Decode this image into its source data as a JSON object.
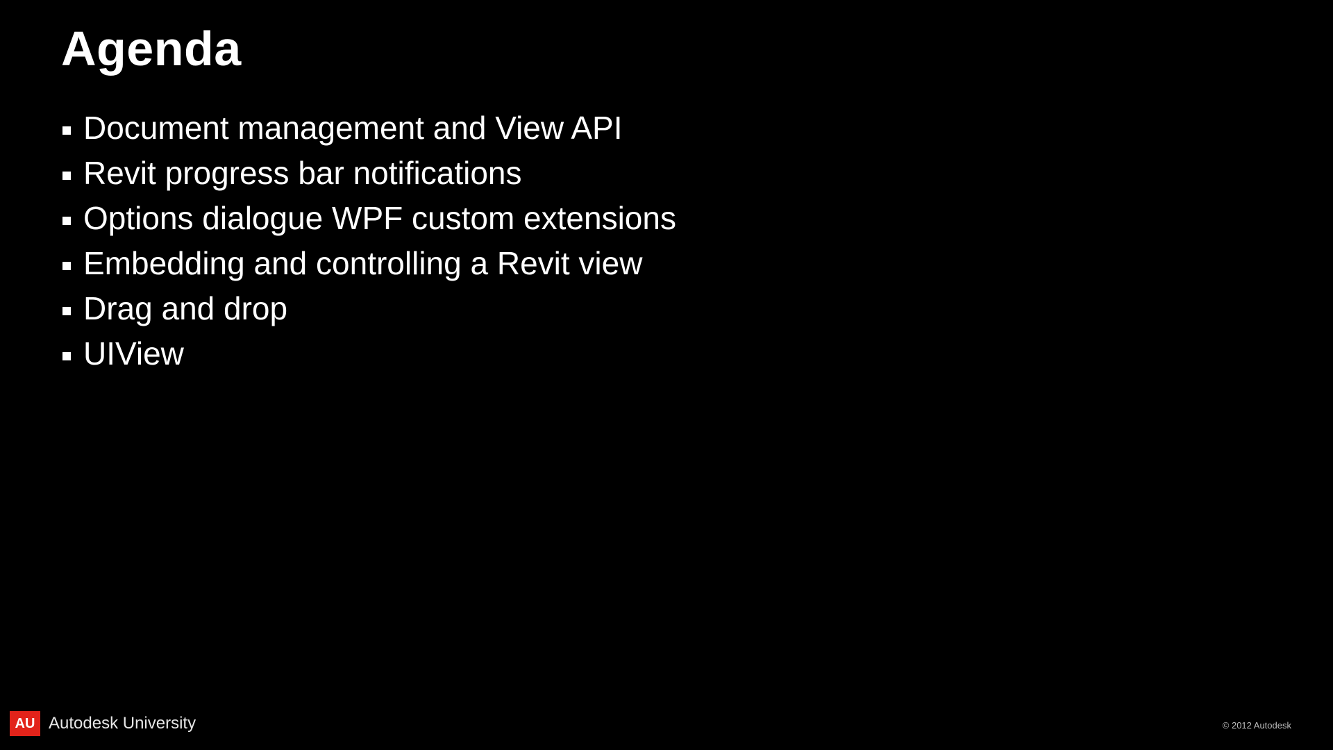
{
  "slide": {
    "title": "Agenda",
    "bullets": [
      "Document management and View API",
      "Revit progress bar notifications",
      "Options dialogue WPF custom extensions",
      "Embedding and controlling a Revit view",
      "Drag and drop",
      "UIView"
    ]
  },
  "footer": {
    "badge": "AU",
    "brand": "Autodesk University",
    "copyright": "© 2012 Autodesk"
  }
}
